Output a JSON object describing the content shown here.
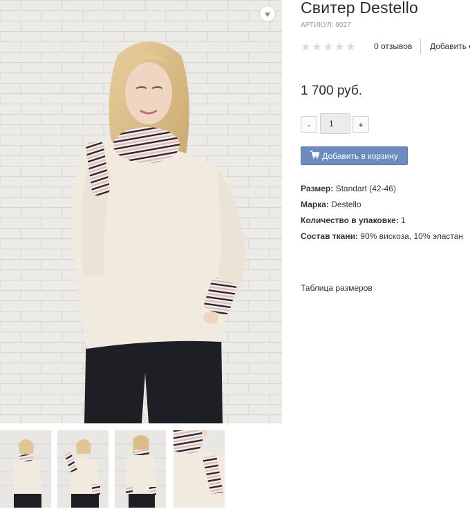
{
  "product": {
    "title": "Свитер Destello",
    "sku": "АРТИКУЛ: 9027",
    "rating": {
      "stars": "★★★★★",
      "reviews": "0 отзывов",
      "add_review": "Добавить о"
    },
    "price": "1 700 руб.",
    "quantity": {
      "minus": "-",
      "value": "1",
      "plus": "+"
    },
    "cart_button": {
      "icon": "shopping-cart-icon",
      "label": "Добавить в корзину"
    },
    "props": [
      {
        "label": "Размер:",
        "value": "Standart (42-46)"
      },
      {
        "label": "Марка:",
        "value": "Destello"
      },
      {
        "label": "Количество в упаковке:",
        "value": "1"
      },
      {
        "label": "Состав ткани:",
        "value": "90% вискоза, 10% эластан"
      }
    ],
    "size_table_link": "Таблица размеров"
  },
  "gallery": {
    "wishlist_icon": "heart-icon",
    "thumbnail_count": 4
  },
  "colors": {
    "accent_button": "#6c8cc0",
    "sweater": "#f1ebdf",
    "pants": "#1e1f24",
    "stripe_pink": "#e7b9be"
  }
}
